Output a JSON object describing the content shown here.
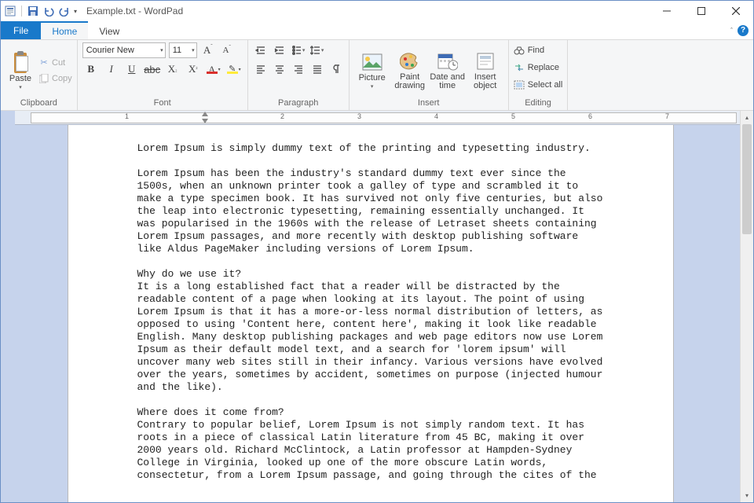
{
  "title": "Example.txt - WordPad",
  "tabs": {
    "file": "File",
    "home": "Home",
    "view": "View"
  },
  "clipboard": {
    "paste": "Paste",
    "cut": "Cut",
    "copy": "Copy",
    "label": "Clipboard"
  },
  "font": {
    "name": "Courier New",
    "size": "11",
    "label": "Font"
  },
  "paragraph": {
    "label": "Paragraph"
  },
  "insert": {
    "picture": "Picture",
    "paint": "Paint\ndrawing",
    "datetime": "Date and\ntime",
    "object": "Insert\nobject",
    "label": "Insert"
  },
  "editing": {
    "find": "Find",
    "replace": "Replace",
    "selectall": "Select all",
    "label": "Editing"
  },
  "ruler": [
    "1",
    "2",
    "3",
    "4",
    "5",
    "6",
    "7"
  ],
  "doc": {
    "p1": "Lorem Ipsum is simply dummy text of the printing and typesetting industry.",
    "p2": "Lorem Ipsum has been the industry's standard dummy text ever since the 1500s, when an unknown printer took a galley of type and scrambled it to make a type specimen book. It has survived not only five centuries, but also the leap into electronic typesetting, remaining essentially unchanged. It was popularised in the 1960s with the release of Letraset sheets containing Lorem Ipsum passages, and more recently with desktop publishing software like Aldus PageMaker including versions of Lorem Ipsum.",
    "p3": "Why do we use it?\nIt is a long established fact that a reader will be distracted by the readable content of a page when looking at its layout. The point of using Lorem Ipsum is that it has a more-or-less normal distribution of letters, as opposed to using 'Content here, content here', making it look like readable English. Many desktop publishing packages and web page editors now use Lorem Ipsum as their default model text, and a search for 'lorem ipsum' will uncover many web sites still in their infancy. Various versions have evolved over the years, sometimes by accident, sometimes on purpose (injected humour and the like).",
    "p4": "Where does it come from?\nContrary to popular belief, Lorem Ipsum is not simply random text. It has roots in a piece of classical Latin literature from 45 BC, making it over 2000 years old. Richard McClintock, a Latin professor at Hampden-Sydney College in Virginia, looked up one of the more obscure Latin words, consectetur, from a Lorem Ipsum passage, and going through the cites of the"
  }
}
